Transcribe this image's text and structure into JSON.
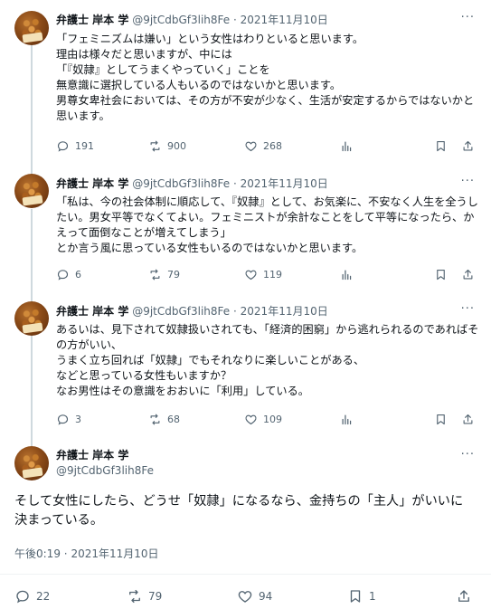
{
  "author": {
    "name": "弁護士 岸本 学",
    "handle": "@9jtCdbGf3lih8Fe"
  },
  "separator_dot": "·",
  "more_glyph": "···",
  "tweets": [
    {
      "date": "2021年11月10日",
      "text": "「フェミニズムは嫌い」という女性はわりといると思います。\n理由は様々だと思いますが、中には\n「『奴隷』としてうまくやっていく」ことを\n無意識に選択している人もいるのではないかと思います。\n男尊女卑社会においては、その方が不安が少なく、生活が安定するからではないかと思います。",
      "replies": "191",
      "retweets": "900",
      "likes": "268"
    },
    {
      "date": "2021年11月10日",
      "text": "「私は、今の社会体制に順応して、『奴隷』として、お気楽に、不安なく人生を全うしたい。男女平等でなくてよい。フェミニストが余計なことをして平等になったら、かえって面倒なことが増えてしまう」\nとか言う風に思っている女性もいるのではないかと思います。",
      "replies": "6",
      "retweets": "79",
      "likes": "119"
    },
    {
      "date": "2021年11月10日",
      "text": "あるいは、見下されて奴隷扱いされても、「経済的困窮」から逃れられるのであればその方がいい、\nうまく立ち回れば「奴隷」でもそれなりに楽しいことがある、\nなどと思っている女性もいますか？\nなお男性はその意識をおおいに「利用」している。",
      "replies": "3",
      "retweets": "68",
      "likes": "109"
    }
  ],
  "focused": {
    "text": "そして女性にしたら、どうせ「奴隷」になるなら、金持ちの「主人」がいいに決まっている。",
    "time": "午後0:19",
    "date": "2021年11月10日",
    "replies": "22",
    "retweets": "79",
    "likes": "94",
    "bookmarks": "1"
  },
  "icons": [
    "reply-icon",
    "retweet-icon",
    "like-icon",
    "views-icon",
    "bookmark-icon",
    "share-icon"
  ],
  "colors": {
    "text": "#0f1419",
    "secondary": "#536471",
    "thread_line": "#cfd9de",
    "border": "#eff3f4"
  }
}
